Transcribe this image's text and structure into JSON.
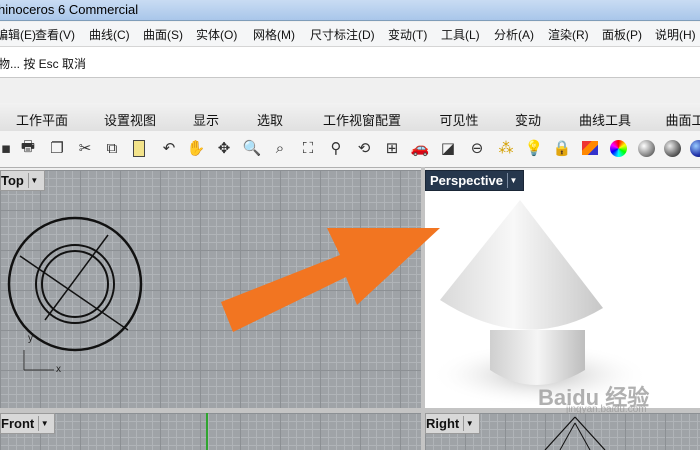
{
  "window": {
    "title": "hinoceros 6 Commercial"
  },
  "menu": [
    "编辑(E)",
    "查看(V)",
    "曲线(C)",
    "曲面(S)",
    "实体(O)",
    "网格(M)",
    "尺寸标注(D)",
    "变动(T)",
    "工具(L)",
    "分析(A)",
    "渲染(R)",
    "面板(P)",
    "说明(H)"
  ],
  "command": {
    "prompt": "物... 按 Esc 取消"
  },
  "tabs": [
    "工作平面",
    "设置视图",
    "显示",
    "选取",
    "工作视窗配置",
    "可见性",
    "变动",
    "曲线工具",
    "曲面工"
  ],
  "toolbar_icons": [
    "save-icon",
    "print-icon",
    "copy-doc-icon",
    "cut-icon",
    "copy-icon",
    "paste-icon",
    "undo-icon",
    "pan-hand-icon",
    "rotate-view-icon",
    "zoom-icon",
    "zoom-window-icon",
    "zoom-extents-icon",
    "zoom-selected-icon",
    "rotate-icon",
    "four-viewports-icon",
    "car-icon",
    "camera-icon",
    "target-icon",
    "select-points-icon",
    "light-icon",
    "lock-icon",
    "layer-icon",
    "color-wheel-icon",
    "sphere-icon",
    "render-sphere-icon",
    "blue-sphere-icon"
  ],
  "viewports": {
    "top": {
      "label": "Top",
      "axis_x": "x",
      "axis_y": "y"
    },
    "perspective": {
      "label": "Perspective"
    },
    "front": {
      "label": "Front"
    },
    "right": {
      "label": "Right"
    }
  },
  "watermark": {
    "text": "Baidu 经验",
    "sub": "jingyan.baidu.com"
  },
  "colors": {
    "arrow": "#f27521",
    "active_label_bg": "#26374d",
    "grid": "#9fa3a7"
  }
}
